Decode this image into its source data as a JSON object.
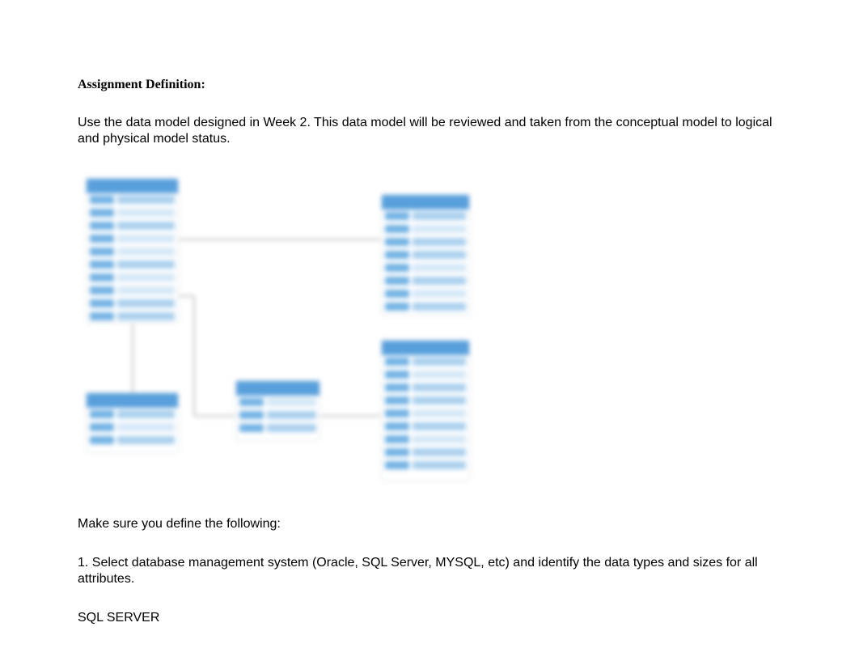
{
  "heading": "Assignment Definition:",
  "intro": "Use the data model designed in Week 2. This data model will be reviewed and taken from the conceptual model to logical and physical model status.",
  "instruction": "Make sure you define the following:",
  "step1": "1. Select database management system (Oracle, SQL Server, MYSQL, etc) and identify the data types and sizes for all attributes.",
  "answer": "SQL SERVER"
}
